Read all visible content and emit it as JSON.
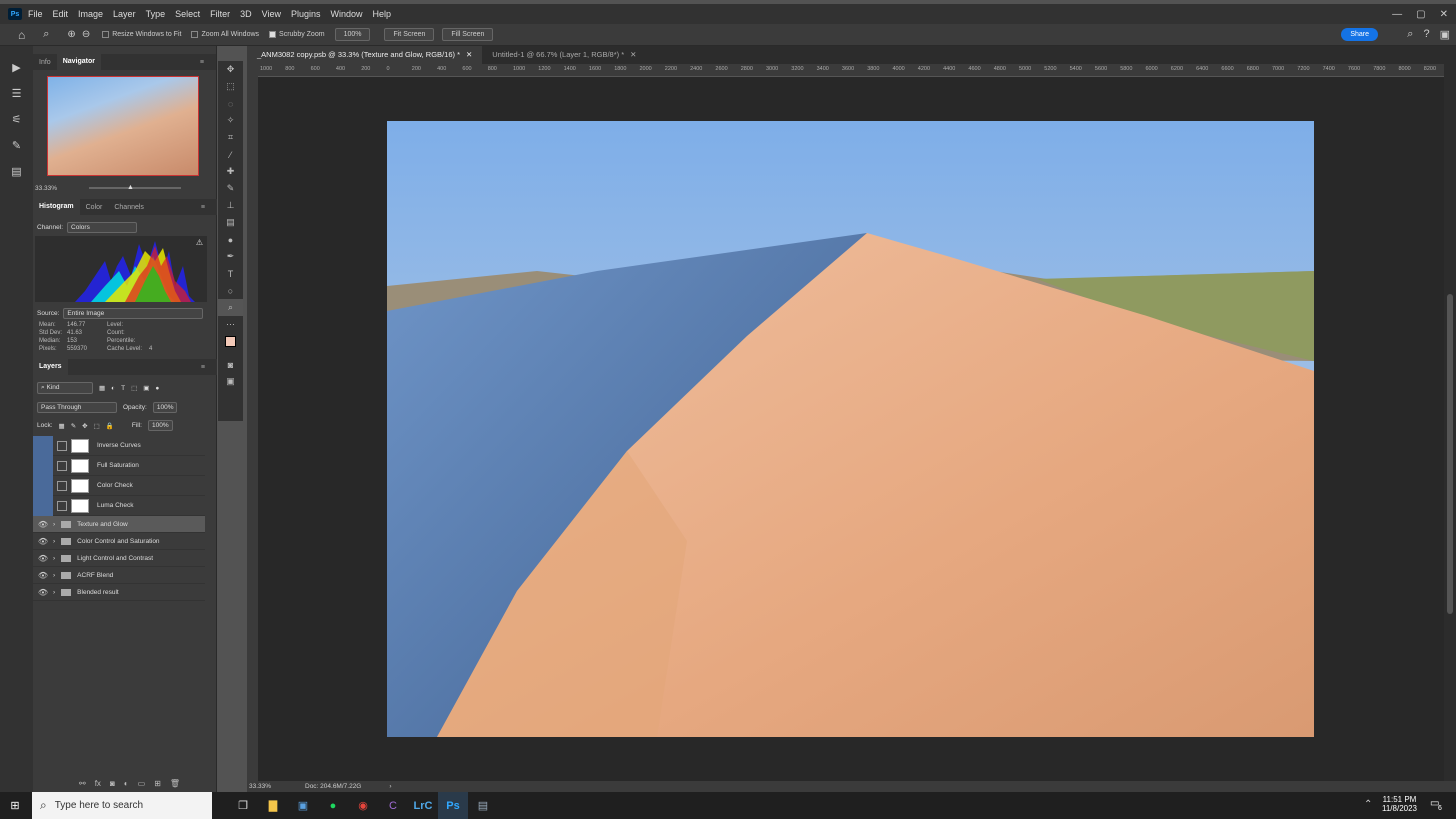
{
  "menubar": {
    "app_badge": "Ps",
    "items": [
      "File",
      "Edit",
      "Image",
      "Layer",
      "Type",
      "Select",
      "Filter",
      "3D",
      "View",
      "Plugins",
      "Window",
      "Help"
    ]
  },
  "options": {
    "resize_windows": "Resize Windows to Fit",
    "zoom_all": "Zoom All Windows",
    "scrubby": "Scrubby Zoom",
    "zoom_value": "100%",
    "fit_screen": "Fit Screen",
    "fill_screen": "Fill Screen",
    "share": "Share"
  },
  "navigator": {
    "tab_info": "Info",
    "tab_navigator": "Navigator",
    "zoom": "33.33%"
  },
  "histogram": {
    "tab_histogram": "Histogram",
    "tab_color": "Color",
    "tab_channels": "Channels",
    "channel_label": "Channel:",
    "channel_value": "Colors",
    "source_label": "Source:",
    "source_value": "Entire Image",
    "stats": [
      [
        "Mean:",
        "146.77",
        "Level:",
        ""
      ],
      [
        "Std Dev:",
        "41.63",
        "Count:",
        ""
      ],
      [
        "Median:",
        "153",
        "Percentile:",
        ""
      ],
      [
        "Pixels:",
        "559370",
        "Cache Level:",
        "4"
      ]
    ]
  },
  "layers": {
    "title": "Layers",
    "kind": "Kind",
    "blend": "Pass Through",
    "opacity_label": "Opacity:",
    "opacity": "100%",
    "lock_label": "Lock:",
    "fill_label": "Fill:",
    "fill": "100%",
    "adjustments": [
      "Inverse Curves",
      "Full Saturation",
      "Color Check",
      "Luma Check"
    ],
    "groups": [
      "Texture and Glow",
      "Color Control and Saturation",
      "Light Control and Contrast",
      "ACRF Blend",
      "Blended result"
    ]
  },
  "doc_tabs": [
    "_ANM3082 copy.psb @ 33.3% (Texture and Glow, RGB/16) *",
    "Untitled-1 @ 66.7% (Layer 1, RGB/8*) *"
  ],
  "ruler_ticks": [
    "1000",
    "800",
    "600",
    "400",
    "200",
    "0",
    "200",
    "400",
    "600",
    "800",
    "1000",
    "1200",
    "1400",
    "1600",
    "1800",
    "2000",
    "2200",
    "2400",
    "2600",
    "2800",
    "3000",
    "3200",
    "3400",
    "3600",
    "3800",
    "4000",
    "4200",
    "4400",
    "4600",
    "4800",
    "5000",
    "5200",
    "5400",
    "5600",
    "5800",
    "6000",
    "6200",
    "6400",
    "6600",
    "6800",
    "7000",
    "7200",
    "7400",
    "7600",
    "7800",
    "8000",
    "8200"
  ],
  "status": {
    "zoom": "33.33%",
    "doc": "Doc: 204.6M/7.22G"
  },
  "taskbar": {
    "search_placeholder": "Type here to search",
    "time": "11:51 PM",
    "date": "11/8/2023",
    "notif": "6"
  }
}
